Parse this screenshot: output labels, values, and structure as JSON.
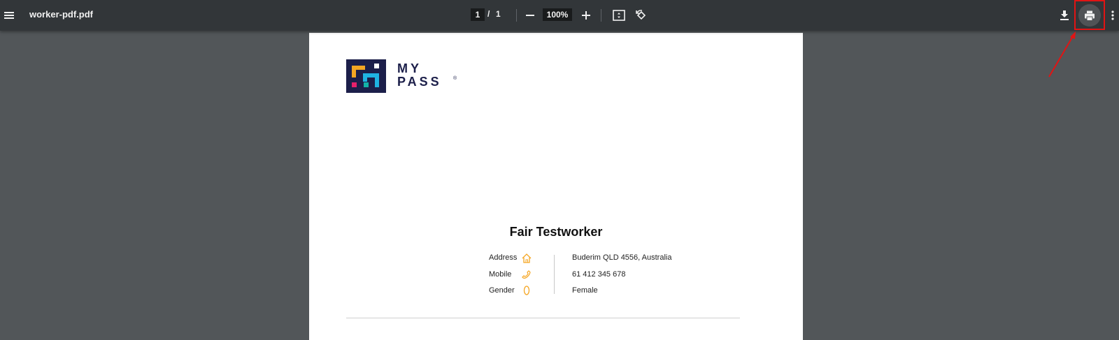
{
  "toolbar": {
    "title": "worker-pdf.pdf",
    "page_current": "1",
    "page_separator": "/",
    "page_total": "1",
    "zoom": "100%"
  },
  "document": {
    "logo_line1": "MY",
    "logo_line2": "PASS",
    "logo_reg": "®",
    "name": "Fair Testworker",
    "details": {
      "address_label": "Address",
      "address_value": "Buderim QLD 4556, Australia",
      "mobile_label": "Mobile",
      "mobile_value": "61 412 345 678",
      "gender_label": "Gender",
      "gender_value": "Female"
    }
  },
  "colors": {
    "toolbar_bg": "#323639",
    "viewer_bg": "#525659",
    "brand_navy": "#1c1f4a",
    "accent_orange": "#f5a623",
    "highlight_red": "#e11414"
  },
  "icons": [
    "menu-icon",
    "zoom-out-icon",
    "zoom-in-icon",
    "fit-page-icon",
    "rotate-icon",
    "download-icon",
    "print-icon",
    "more-vert-icon",
    "home-icon",
    "phone-icon",
    "gender-icon"
  ]
}
